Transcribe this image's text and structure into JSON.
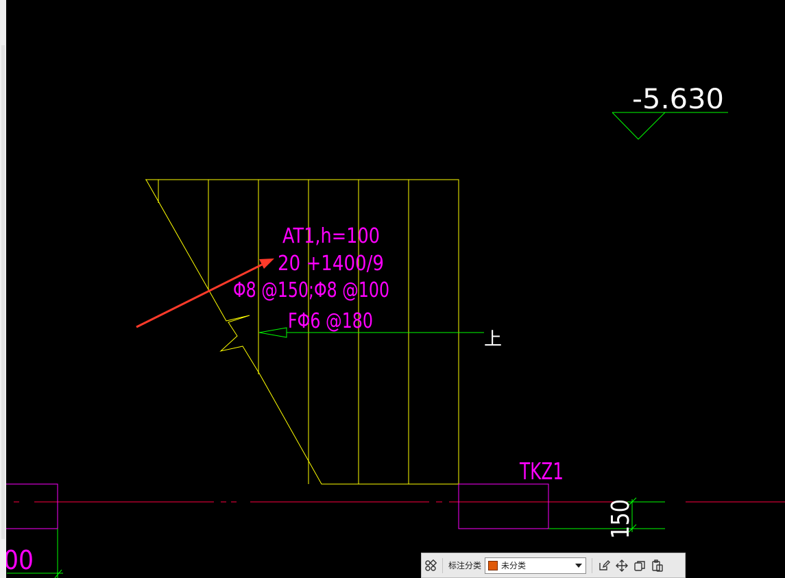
{
  "drawing": {
    "elevation_label": "-5.630",
    "stair_labels": [
      "AT1,h=100",
      "20 +1400/9",
      "Φ8 @150;Φ8 @100",
      "FΦ6 @180"
    ],
    "direction_label": "上",
    "column_label": "TKZ1",
    "dimension_label": "150",
    "partial_text_left": "00"
  },
  "colors": {
    "background": "#000000",
    "stair_outline": "#ffff00",
    "annotation_text": "#ff00ff",
    "column_outline": "#ff00ff",
    "axis_line": "#ff0040",
    "dimension_line": "#00ff00",
    "pointer_arrow": "#ff3a2a",
    "category_swatch": "#e05a0a"
  },
  "toolbar": {
    "category_label": "标注分类",
    "category_value": "未分类",
    "icons": [
      "grid-view-icon",
      "edit-icon",
      "move-icon",
      "copy-icon",
      "paste-icon"
    ]
  }
}
